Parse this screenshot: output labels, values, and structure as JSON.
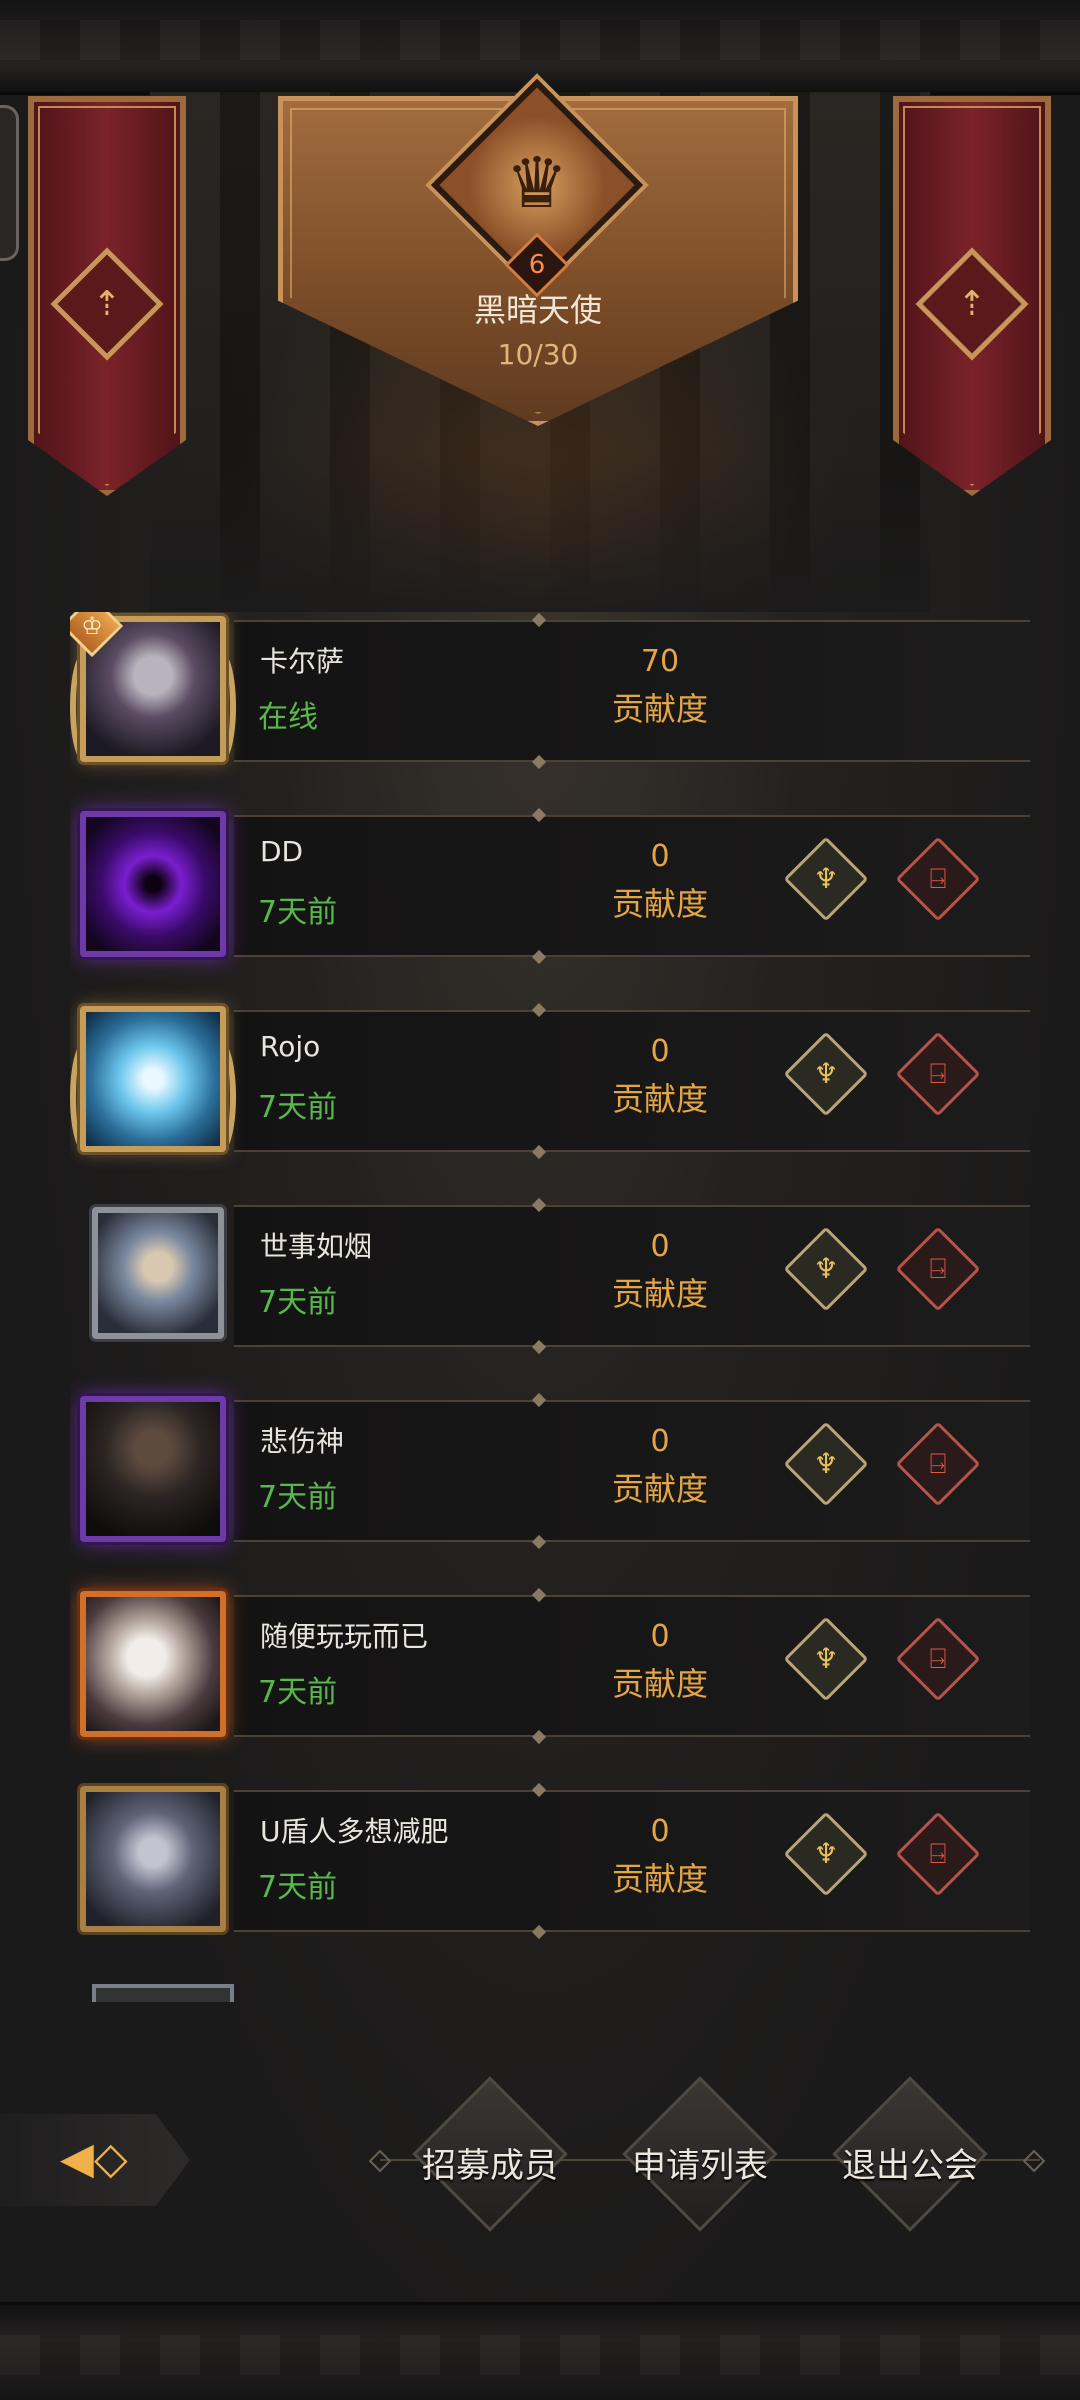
{
  "guild": {
    "name": "黑暗天使",
    "level": "6",
    "member_count": "10/30"
  },
  "members": [
    {
      "name": "卡尔萨",
      "status": "在线",
      "points": "70",
      "points_label": "贡献度",
      "avatar_icon": "elf-portrait-icon",
      "is_leader": true
    },
    {
      "name": "DD",
      "status": "7天前",
      "points": "0",
      "points_label": "贡献度",
      "avatar_icon": "purple-vortex-icon"
    },
    {
      "name": "Rojo",
      "status": "7天前",
      "points": "0",
      "points_label": "贡献度",
      "avatar_icon": "ice-crystal-icon"
    },
    {
      "name": "世事如烟",
      "status": "7天前",
      "points": "0",
      "points_label": "贡献度",
      "avatar_icon": "elf-queen-portrait-icon"
    },
    {
      "name": "悲伤神",
      "status": "7天前",
      "points": "0",
      "points_label": "贡献度",
      "avatar_icon": "hooded-figure-icon"
    },
    {
      "name": "随便玩玩而已",
      "status": "7天前",
      "points": "0",
      "points_label": "贡献度",
      "avatar_icon": "white-hair-elf-icon"
    },
    {
      "name": "U盾人多想减肥",
      "status": "7天前",
      "points": "0",
      "points_label": "贡献度",
      "avatar_icon": "armored-elf-icon"
    }
  ],
  "actions": {
    "recruit_label": "招募成员",
    "apply_list_label": "申请列表",
    "quit_label": "退出公会"
  },
  "colors": {
    "online": "#59b84c",
    "points": "#e3a545",
    "banner": "#7a2329",
    "promote_icon": "#e8c15b",
    "kick_icon": "#e05a48"
  }
}
